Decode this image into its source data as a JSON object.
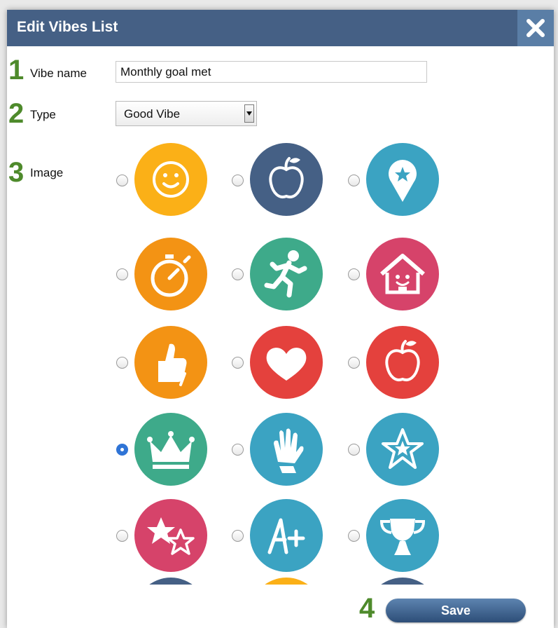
{
  "dialog": {
    "title": "Edit Vibes List",
    "close_icon": "close-icon"
  },
  "steps": [
    "1",
    "2",
    "3",
    "4"
  ],
  "form": {
    "vibe_name_label": "Vibe name",
    "vibe_name_value": "Monthly goal met",
    "type_label": "Type",
    "type_value": "Good Vibe",
    "image_label": "Image"
  },
  "images": [
    {
      "icon": "smiley-face-icon",
      "color": "#fbb017",
      "selected": false
    },
    {
      "icon": "apple-icon",
      "color": "#456085",
      "selected": false
    },
    {
      "icon": "map-pin-star-icon",
      "color": "#3ba3c2",
      "selected": false
    },
    {
      "icon": "stopwatch-icon",
      "color": "#f39314",
      "selected": false
    },
    {
      "icon": "running-person-icon",
      "color": "#3eaa8a",
      "selected": false
    },
    {
      "icon": "smiling-house-icon",
      "color": "#d6436a",
      "selected": false
    },
    {
      "icon": "thumbs-up-icon",
      "color": "#f39314",
      "selected": false
    },
    {
      "icon": "heart-icon",
      "color": "#e4413d",
      "selected": false
    },
    {
      "icon": "apple-icon",
      "color": "#e4413d",
      "selected": false
    },
    {
      "icon": "crown-icon",
      "color": "#3eaa8a",
      "selected": true
    },
    {
      "icon": "raised-hand-icon",
      "color": "#3ba3c2",
      "selected": false
    },
    {
      "icon": "star-badge-icon",
      "color": "#3ba3c2",
      "selected": false
    },
    {
      "icon": "two-stars-icon",
      "color": "#d6436a",
      "selected": false
    },
    {
      "icon": "a-plus-grade-icon",
      "color": "#3ba3c2",
      "selected": false
    },
    {
      "icon": "trophy-icon",
      "color": "#3ba3c2",
      "selected": false
    },
    {
      "icon": "partial-icon",
      "color": "#456085",
      "selected": false
    },
    {
      "icon": "partial-icon",
      "color": "#fbb017",
      "selected": false
    },
    {
      "icon": "partial-icon",
      "color": "#456085",
      "selected": false
    }
  ],
  "save_label": "Save",
  "colors": {
    "titlebar": "#456085",
    "step_number": "#4e8a2b",
    "save_button": "#3f6493"
  }
}
